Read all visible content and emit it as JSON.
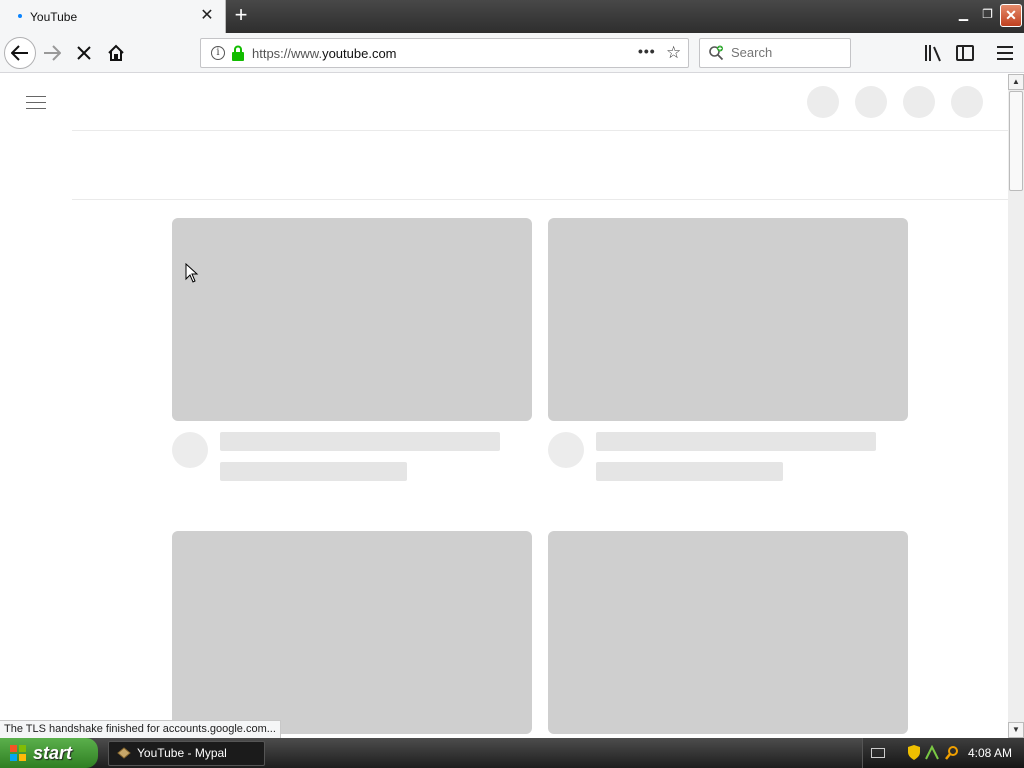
{
  "browser": {
    "tab": {
      "title": "YouTube",
      "close_glyph": "✕"
    },
    "new_tab_glyph": "+",
    "window_controls": {
      "minimize": "▁",
      "maximize": "❐",
      "close": "✕"
    },
    "nav": {
      "back_icon": "arrow-left-icon",
      "forward_icon": "arrow-right-icon",
      "stop_icon": "close-icon",
      "home_icon": "home-icon"
    },
    "url": {
      "prefix": "https://www.",
      "domain": "youtube.com"
    },
    "url_info_glyph": "i",
    "url_more_glyph": "•••",
    "url_star_glyph": "☆",
    "search": {
      "placeholder": "Search"
    },
    "status_text": "The TLS handshake finished for accounts.google.com..."
  },
  "taskbar": {
    "start_label": "start",
    "task_item_label": "YouTube - Mypal",
    "clock": "4:08 AM"
  },
  "colors": {
    "skeleton_thumb": "#cfcfcf",
    "skeleton_line": "#e5e5e5",
    "secure_lock": "#12bc00",
    "start_green": "#3c8f2e"
  }
}
